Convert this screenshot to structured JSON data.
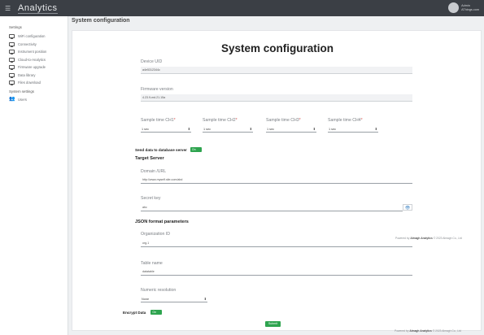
{
  "app": {
    "brand": "Analytics"
  },
  "user": {
    "name": "Admin",
    "role": "AThings.com"
  },
  "sidebar": {
    "sections": [
      {
        "title": "Settings"
      },
      {
        "title": "System settings"
      }
    ],
    "items": [
      {
        "label": "WiFi configuration"
      },
      {
        "label": "Connectivity"
      },
      {
        "label": "Instrument position"
      },
      {
        "label": "Cloud-to-Analytics"
      },
      {
        "label": "Firmware upgrade"
      },
      {
        "label": "Data library"
      },
      {
        "label": "Files download"
      }
    ],
    "system_items": [
      {
        "label": "Users"
      }
    ]
  },
  "page": {
    "title": "System configuration"
  },
  "form": {
    "heading": "System configuration",
    "device_uid": {
      "label": "Device UID",
      "value": "a4e5312344c"
    },
    "firmware": {
      "label": "Firmware version",
      "value": "4.23.9-md.21.15a"
    },
    "sample_times": [
      {
        "label": "Sample time CH1",
        "value": "1 sec"
      },
      {
        "label": "Sample time CH2",
        "value": "1 sec"
      },
      {
        "label": "Sample time CH3",
        "value": "1 sec"
      },
      {
        "label": "Sample time CH4",
        "value": "1 sec"
      }
    ],
    "required_mark": "*",
    "send_to_server": {
      "label": "Send data to database server",
      "state": "On"
    },
    "target_server_heading": "Target Server",
    "domain": {
      "label": "Domain /URL",
      "value": "http://www.myself.site.com/abd"
    },
    "secret_key": {
      "label": "Secret key",
      "value": "abc"
    },
    "json_heading": "JSON format parameters",
    "organization_id": {
      "label": "Organization ID",
      "value": "org.1"
    },
    "table_name": {
      "label": "Table name",
      "value": "datatable"
    },
    "numeric_resolution": {
      "label": "Numeric resolution",
      "value": "None"
    },
    "encrypt": {
      "label": "Encrypt Data",
      "state": "On"
    },
    "submit_label": "Submit"
  },
  "footer": {
    "prefix": "Powered by",
    "brand": "Almagh Analytics",
    "suffix": "© 2023 Almagh Co., Ltd"
  },
  "colors": {
    "topbar": "#3b3f45",
    "accent_green": "#2ea44f",
    "required": "#d9534f",
    "eye": "#2f7bbf"
  }
}
